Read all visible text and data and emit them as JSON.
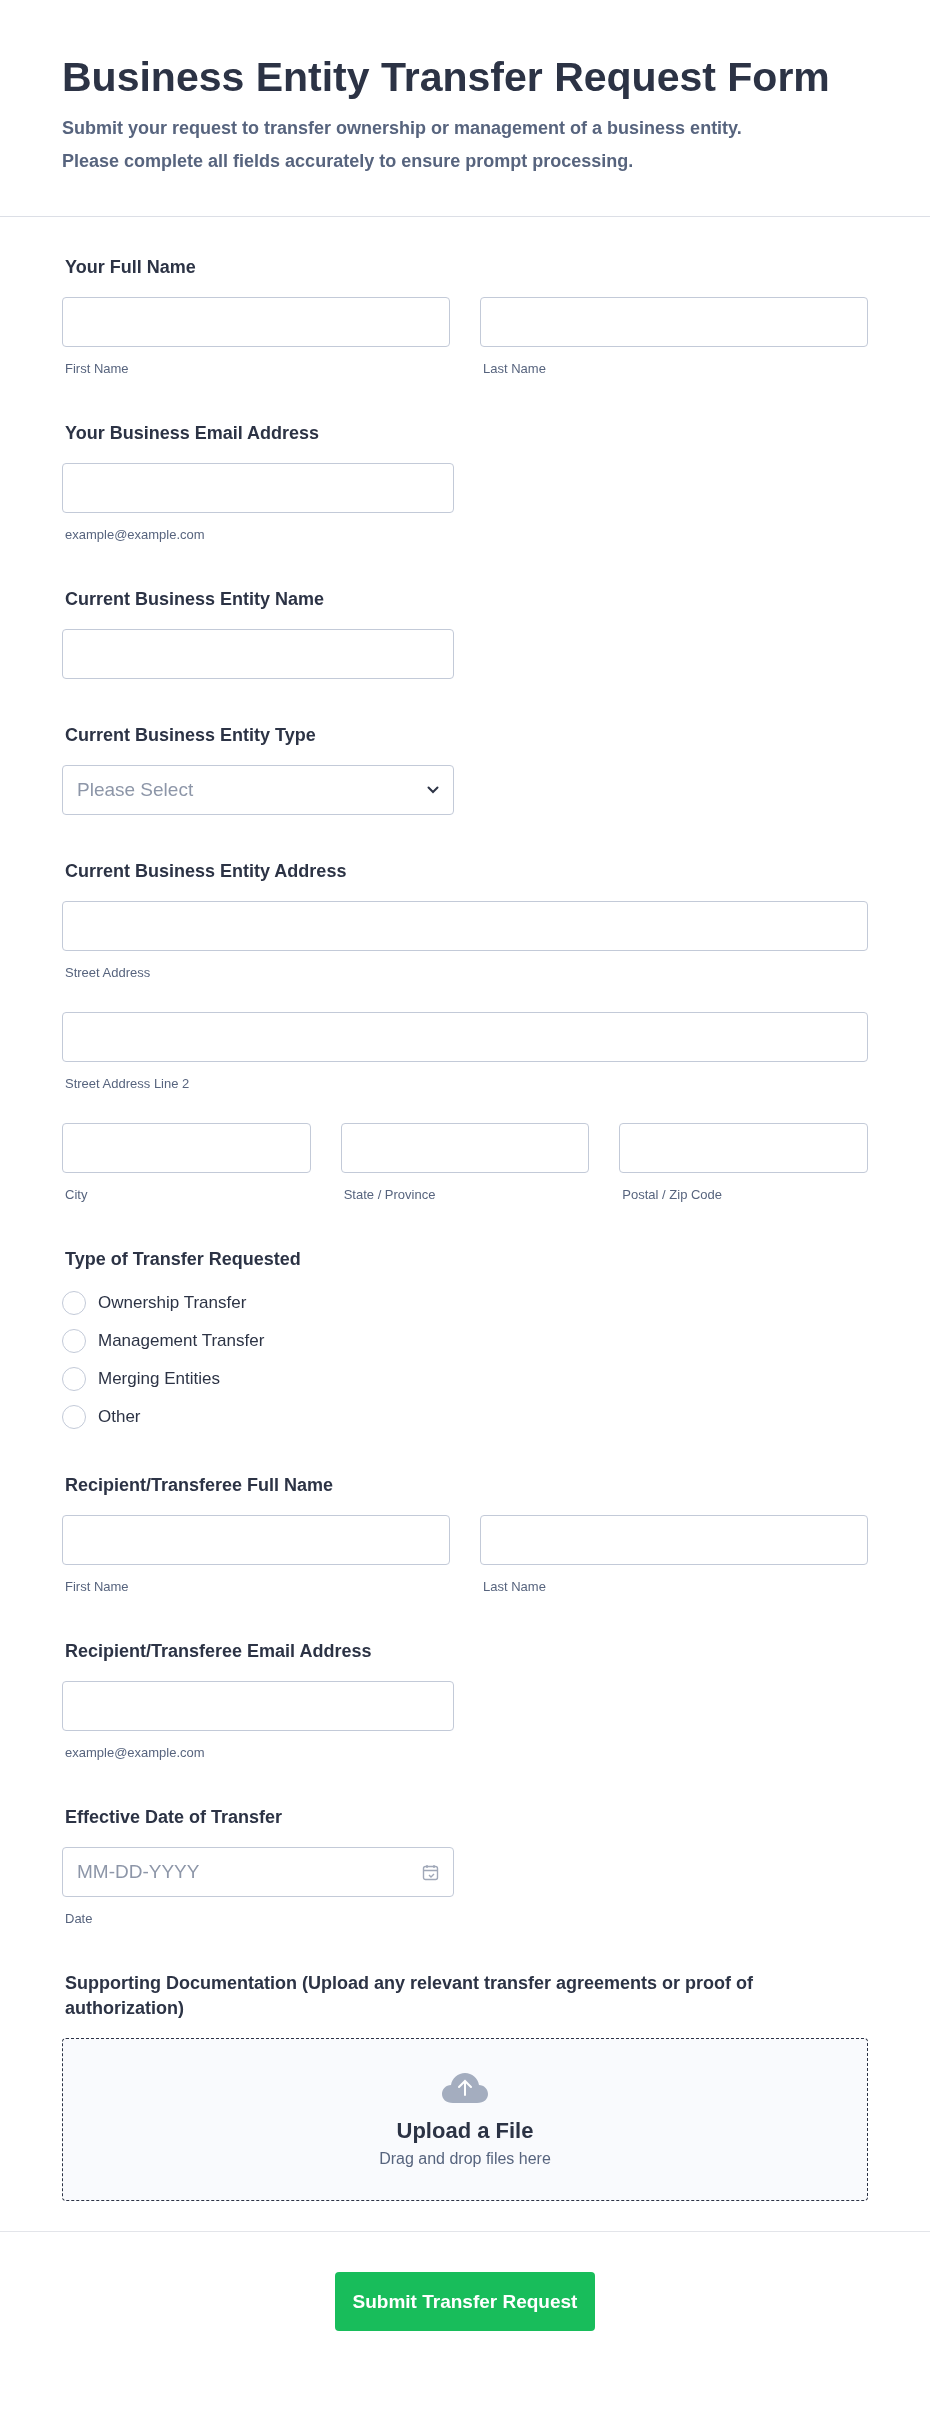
{
  "header": {
    "title": "Business Entity Transfer Request Form",
    "subtitle_lines": [
      "Submit your request to transfer ownership or management of a business entity.",
      "Please complete all fields accurately to ensure prompt processing."
    ]
  },
  "sections": [
    {
      "kind": "fields",
      "label": "Your Full Name",
      "rows": [
        [
          {
            "sublabel": "First Name",
            "kind": "half"
          },
          {
            "sublabel": "Last Name",
            "kind": "half"
          }
        ]
      ]
    },
    {
      "kind": "fields",
      "label": "Your Business Email Address",
      "rows": [
        [
          {
            "sublabel": "example@example.com",
            "kind": "half"
          }
        ]
      ]
    },
    {
      "kind": "fields",
      "label": "Current Business Entity Name",
      "rows": [
        [
          {
            "kind": "half"
          }
        ]
      ]
    },
    {
      "kind": "select",
      "label": "Current Business Entity Type",
      "placeholder": "Please Select"
    },
    {
      "kind": "fields",
      "label": "Current Business Entity Address",
      "rows": [
        [
          {
            "sublabel": "Street Address",
            "kind": "full"
          }
        ],
        [
          {
            "sublabel": "Street Address Line 2",
            "kind": "full"
          }
        ],
        [
          {
            "sublabel": "City",
            "kind": "third"
          },
          {
            "sublabel": "State / Province",
            "kind": "third"
          },
          {
            "sublabel": "Postal / Zip Code",
            "kind": "third"
          }
        ]
      ]
    },
    {
      "kind": "radio",
      "label": "Type of Transfer Requested",
      "options": [
        {
          "label": "Ownership Transfer",
          "selected": false
        },
        {
          "label": "Management Transfer",
          "selected": false
        },
        {
          "label": "Merging Entities",
          "selected": false
        },
        {
          "label": "Other",
          "selected": false
        }
      ]
    },
    {
      "kind": "fields",
      "label": "Recipient/Transferee Full Name",
      "rows": [
        [
          {
            "sublabel": "First Name",
            "kind": "half"
          },
          {
            "sublabel": "Last Name",
            "kind": "half"
          }
        ]
      ]
    },
    {
      "kind": "fields",
      "label": "Recipient/Transferee Email Address",
      "rows": [
        [
          {
            "sublabel": "example@example.com",
            "kind": "half"
          }
        ]
      ]
    },
    {
      "kind": "date",
      "label": "Effective Date of Transfer",
      "placeholder": "MM-DD-YYYY",
      "sublabel": "Date"
    },
    {
      "kind": "upload",
      "label": "Supporting Documentation (Upload any relevant transfer agreements or proof of authorization)",
      "title": "Upload a File",
      "hint": "Drag and drop files here"
    }
  ],
  "submit": {
    "label": "Submit Transfer Request"
  }
}
